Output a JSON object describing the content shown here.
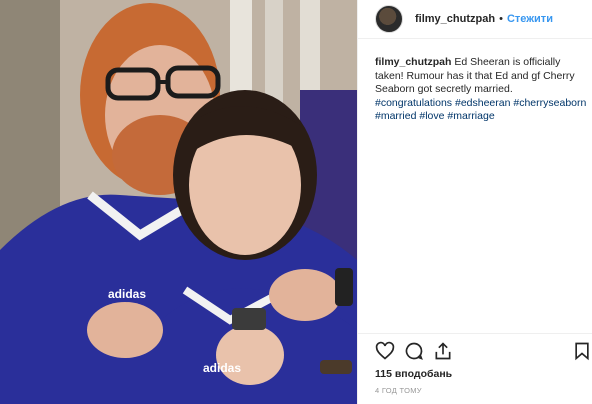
{
  "post": {
    "username": "filmy_chutzpah",
    "separator": "•",
    "follow_label": "Стежити",
    "caption": {
      "user": "filmy_chutzpah",
      "text": "Ed Sheeran is officially taken! Rumour has it that Ed and gf Cherry Seaborn got secretly married.",
      "hashtags": [
        "#congratulations",
        "#edsheeran",
        "#cherryseaborn",
        "#married",
        "#love",
        "#marriage"
      ]
    },
    "likes": "115 вподобань",
    "timestamp": "4 ГОД ТОМУ"
  },
  "photo": {
    "jersey_brand": "adidas"
  },
  "icons": {
    "like": "heart-icon",
    "comment": "comment-icon",
    "share": "share-icon",
    "save": "bookmark-icon"
  },
  "colors": {
    "link": "#3897f0",
    "hashtag": "#003569",
    "jersey": "#2a2f9a"
  }
}
